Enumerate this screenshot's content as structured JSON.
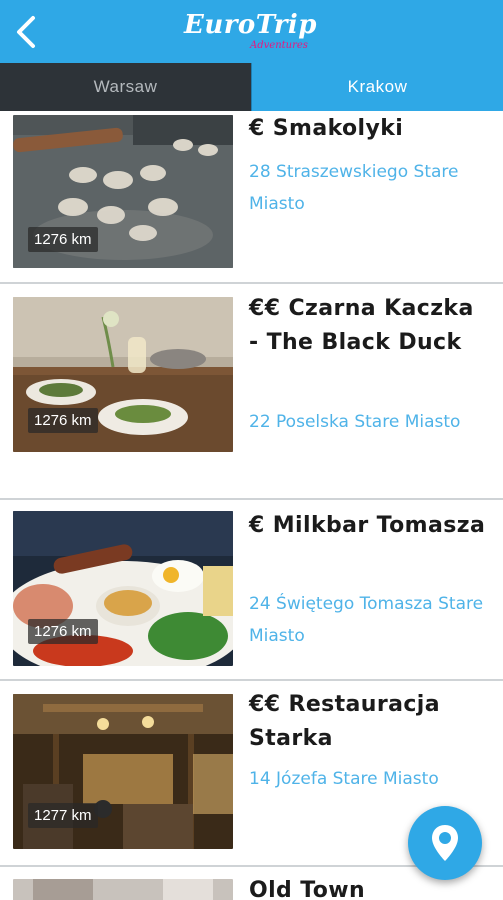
{
  "appbar": {
    "logo_title": "EuroTrip",
    "logo_subtitle": "Adventures",
    "accent": "#2fa8e6",
    "back_icon": "arrow-left-icon"
  },
  "tabs": [
    {
      "label": "Warsaw",
      "selected": false
    },
    {
      "label": "Krakow",
      "selected": true
    }
  ],
  "restaurants": [
    {
      "price": "€",
      "name": "€ Smakolyki",
      "address": "28 Straszewskiego Stare Miasto",
      "distance": "1276 km"
    },
    {
      "price": "€€",
      "name": "€€ Czarna Kaczka - The Black Duck",
      "address": "22 Poselska Stare Miasto",
      "distance": "1276 km"
    },
    {
      "price": "€",
      "name": "€ Milkbar Tomasza",
      "address": "24 Świętego Tomasza Stare Miasto",
      "distance": "1276 km"
    },
    {
      "price": "€€",
      "name": "€€ Restauracja Starka",
      "address": "14 Józefa Stare Miasto",
      "distance": "1277 km"
    },
    {
      "name": "Old Town"
    }
  ],
  "fab": {
    "icon": "location-pin-icon"
  }
}
